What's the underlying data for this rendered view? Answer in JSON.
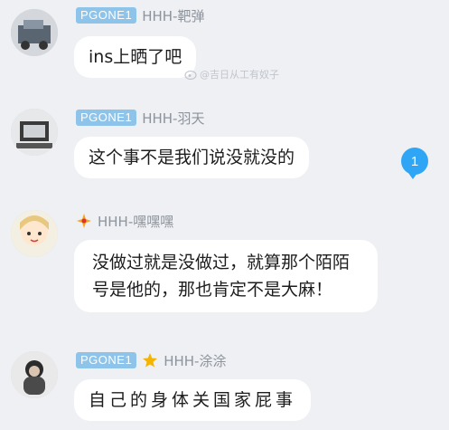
{
  "watermark": {
    "text": "@吉日从工有奴子",
    "icon": "weibo-icon"
  },
  "unread_count": "1",
  "messages": [
    {
      "badge": "PGONE1",
      "name": "HHH-靶弹",
      "text": "ins上晒了吧",
      "avatar": "avatar-icon"
    },
    {
      "badge": "PGONE1",
      "name": "HHH-羽天",
      "text": "这个事不是我们说没就没的",
      "avatar": "avatar-icon"
    },
    {
      "badge": "",
      "name": "HHH-嘿嘿嘿",
      "text": "没做过就是没做过，就算那个陌陌号是他的，那也肯定不是大麻！",
      "avatar": "avatar-icon",
      "icon": "diamond-star-icon"
    },
    {
      "badge": "PGONE1",
      "name": "HHH-涂涂",
      "text": "自己的身体关国家屁事",
      "avatar": "avatar-icon",
      "icon": "star-icon"
    }
  ],
  "colors": {
    "badge": "#8fc4ea",
    "unread": "#2fa6f5",
    "background": "#eef0f4"
  }
}
